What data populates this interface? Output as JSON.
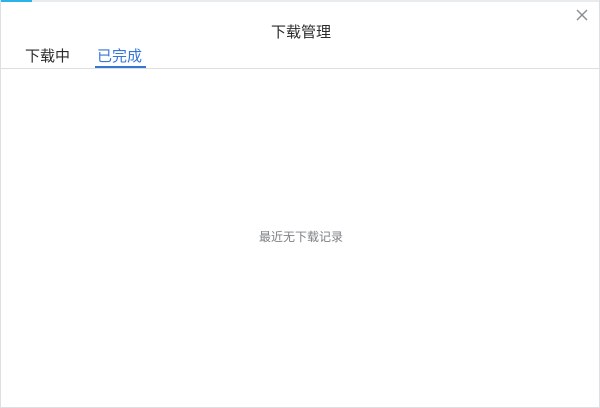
{
  "dialog": {
    "title": "下载管理",
    "close_icon": "close-icon"
  },
  "tabs": [
    {
      "label": "下载中",
      "active": false
    },
    {
      "label": "已完成",
      "active": true
    }
  ],
  "content": {
    "empty_message": "最近无下载记录"
  },
  "colors": {
    "accent": "#3576d6",
    "text": "#2b2b2b",
    "muted": "#7d8085"
  }
}
